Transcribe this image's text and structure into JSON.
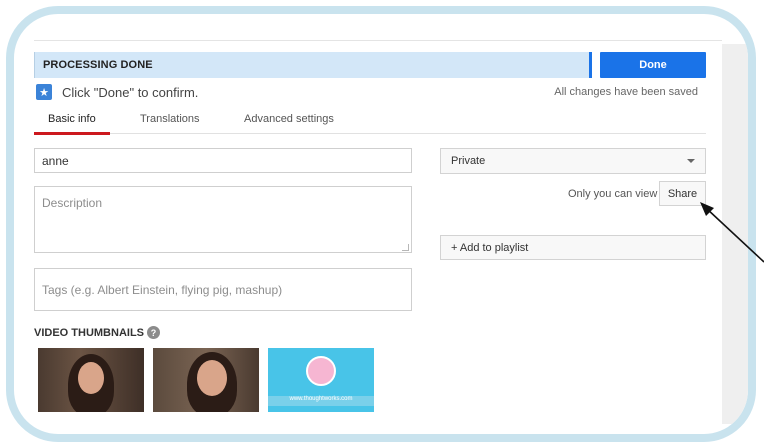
{
  "status": {
    "processing": "PROCESSING DONE",
    "done_label": "Done",
    "confirm": "Click \"Done\" to confirm.",
    "saved": "All changes have been saved"
  },
  "tabs": [
    {
      "label": "Basic info",
      "active": true
    },
    {
      "label": "Translations",
      "active": false
    },
    {
      "label": "Advanced settings",
      "active": false
    }
  ],
  "form": {
    "title_value": "anne",
    "description_placeholder": "Description",
    "tags_placeholder": "Tags (e.g. Albert Einstein, flying pig, mashup)"
  },
  "privacy": {
    "selected": "Private",
    "only_you": "Only you can view",
    "share_label": "Share",
    "playlist_label": "+ Add to playlist"
  },
  "thumbnails": {
    "label": "VIDEO THUMBNAILS",
    "help": "?",
    "url_text": "www.thoughtworks.com"
  },
  "icons": {
    "star": "star-icon",
    "help": "help-icon",
    "chevron": "chevron-down-icon",
    "arrow": "annotation-arrow"
  },
  "colors": {
    "accent": "#1a73e8",
    "tab_active": "#cc181e",
    "banner": "#d3e7f8",
    "frame": "#c9e3ee"
  }
}
